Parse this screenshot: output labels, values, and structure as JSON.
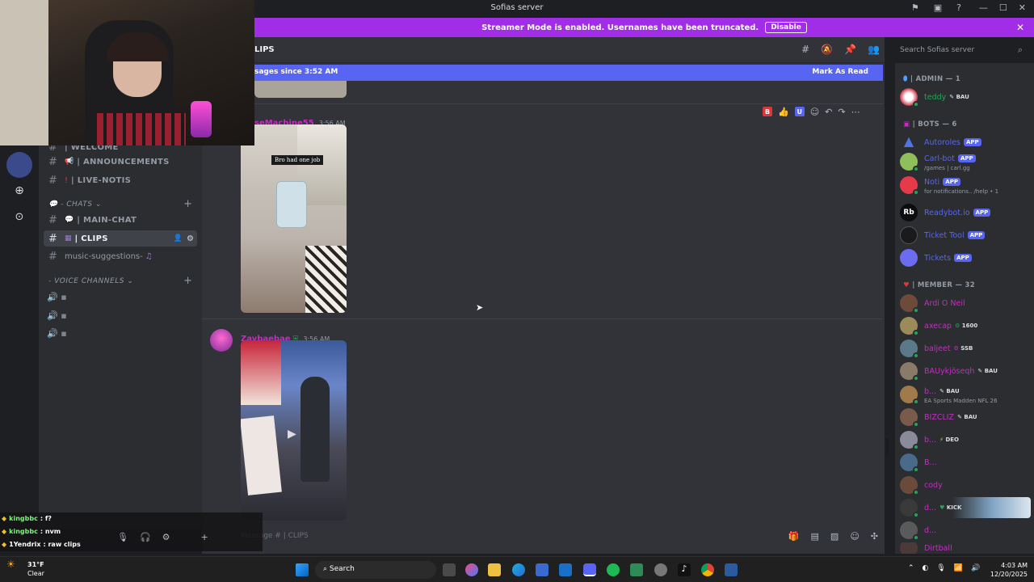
{
  "window": {
    "title": "Sofias server"
  },
  "banner": {
    "text": "Streamer Mode is enabled. Usernames have been truncated.",
    "disable_label": "Disable"
  },
  "header": {
    "channel": "LIPS",
    "search_placeholder": "Search Sofias server"
  },
  "new_messages": {
    "text": "sages since 3:52 AM",
    "mark_read": "Mark As Read"
  },
  "channels": {
    "welcome": "| WELCOME",
    "announcements": "| ANNOUNCEMENTS",
    "live_notis": "| LIVE-NOTIS",
    "chats_category": "CHATS",
    "main_chat": "| MAIN-CHAT",
    "clips": "| CLIPS",
    "music": "music-suggestions-",
    "voice_category": "- VOICE CHANNELS"
  },
  "messages": [
    {
      "author": "seMachine55",
      "time": "3:56 AM",
      "caption": "Bro had one job"
    },
    {
      "author": "Zaybaebae",
      "time": "3:56 AM"
    }
  ],
  "composer": {
    "placeholder": "Message # | CLIPS"
  },
  "members": {
    "admin_header": "| ADMIN — 1",
    "bots_header": "| BOTS — 6",
    "member_header": "| MEMBER — 32",
    "admin": [
      {
        "name": "teddy",
        "badge": "BAU",
        "color": "#23a559"
      }
    ],
    "bots": [
      {
        "name": "Autoroles",
        "tag": "APP",
        "sub": ""
      },
      {
        "name": "Carl-bot",
        "tag": "APP",
        "sub": "/games | carl.gg"
      },
      {
        "name": "Noti",
        "tag": "APP",
        "sub": "for notifications.. /help • 1"
      },
      {
        "name": "Readybot.io",
        "tag": "APP",
        "sub": ""
      },
      {
        "name": "Ticket Tool",
        "tag": "APP",
        "sub": ""
      },
      {
        "name": "Tickets",
        "tag": "APP",
        "sub": ""
      }
    ],
    "members": [
      {
        "name": "Ardi O Neil",
        "badge": "",
        "sub": ""
      },
      {
        "name": "axecap",
        "badge": "1600",
        "sub": ""
      },
      {
        "name": "baljeet",
        "badge": "SSB",
        "sub": ""
      },
      {
        "name": "BAUykjöseqh",
        "badge": "BAU",
        "sub": ""
      },
      {
        "name": "b...",
        "badge": "BAU",
        "sub": "EA Sports Madden NFL 26"
      },
      {
        "name": "BIZCLIZ",
        "badge": "BAU",
        "sub": ""
      },
      {
        "name": "b...",
        "badge": "DEO",
        "sub": ""
      },
      {
        "name": "B...",
        "badge": "",
        "sub": ""
      },
      {
        "name": "cody",
        "badge": "",
        "sub": ""
      },
      {
        "name": "d...",
        "badge": "KICK",
        "sub": ""
      },
      {
        "name": "d...",
        "badge": "",
        "sub": ""
      },
      {
        "name": "Dirtball",
        "badge": "",
        "sub": ""
      }
    ]
  },
  "overlay_chat": [
    {
      "user": "kingbbc",
      "text": ": f?"
    },
    {
      "user": "kingbbc",
      "text": ": nvm"
    },
    {
      "user": "1Yendrix",
      "text": ": raw clips"
    }
  ],
  "taskbar": {
    "temp": "31°F",
    "weather": "Clear",
    "search": "Search",
    "time": "4:03 AM",
    "date": "12/20/2025"
  },
  "colors": {
    "accent": "#5865f2",
    "streamer_banner": "#a12ee6",
    "online": "#23a559",
    "member_name": "#c72bc4"
  }
}
